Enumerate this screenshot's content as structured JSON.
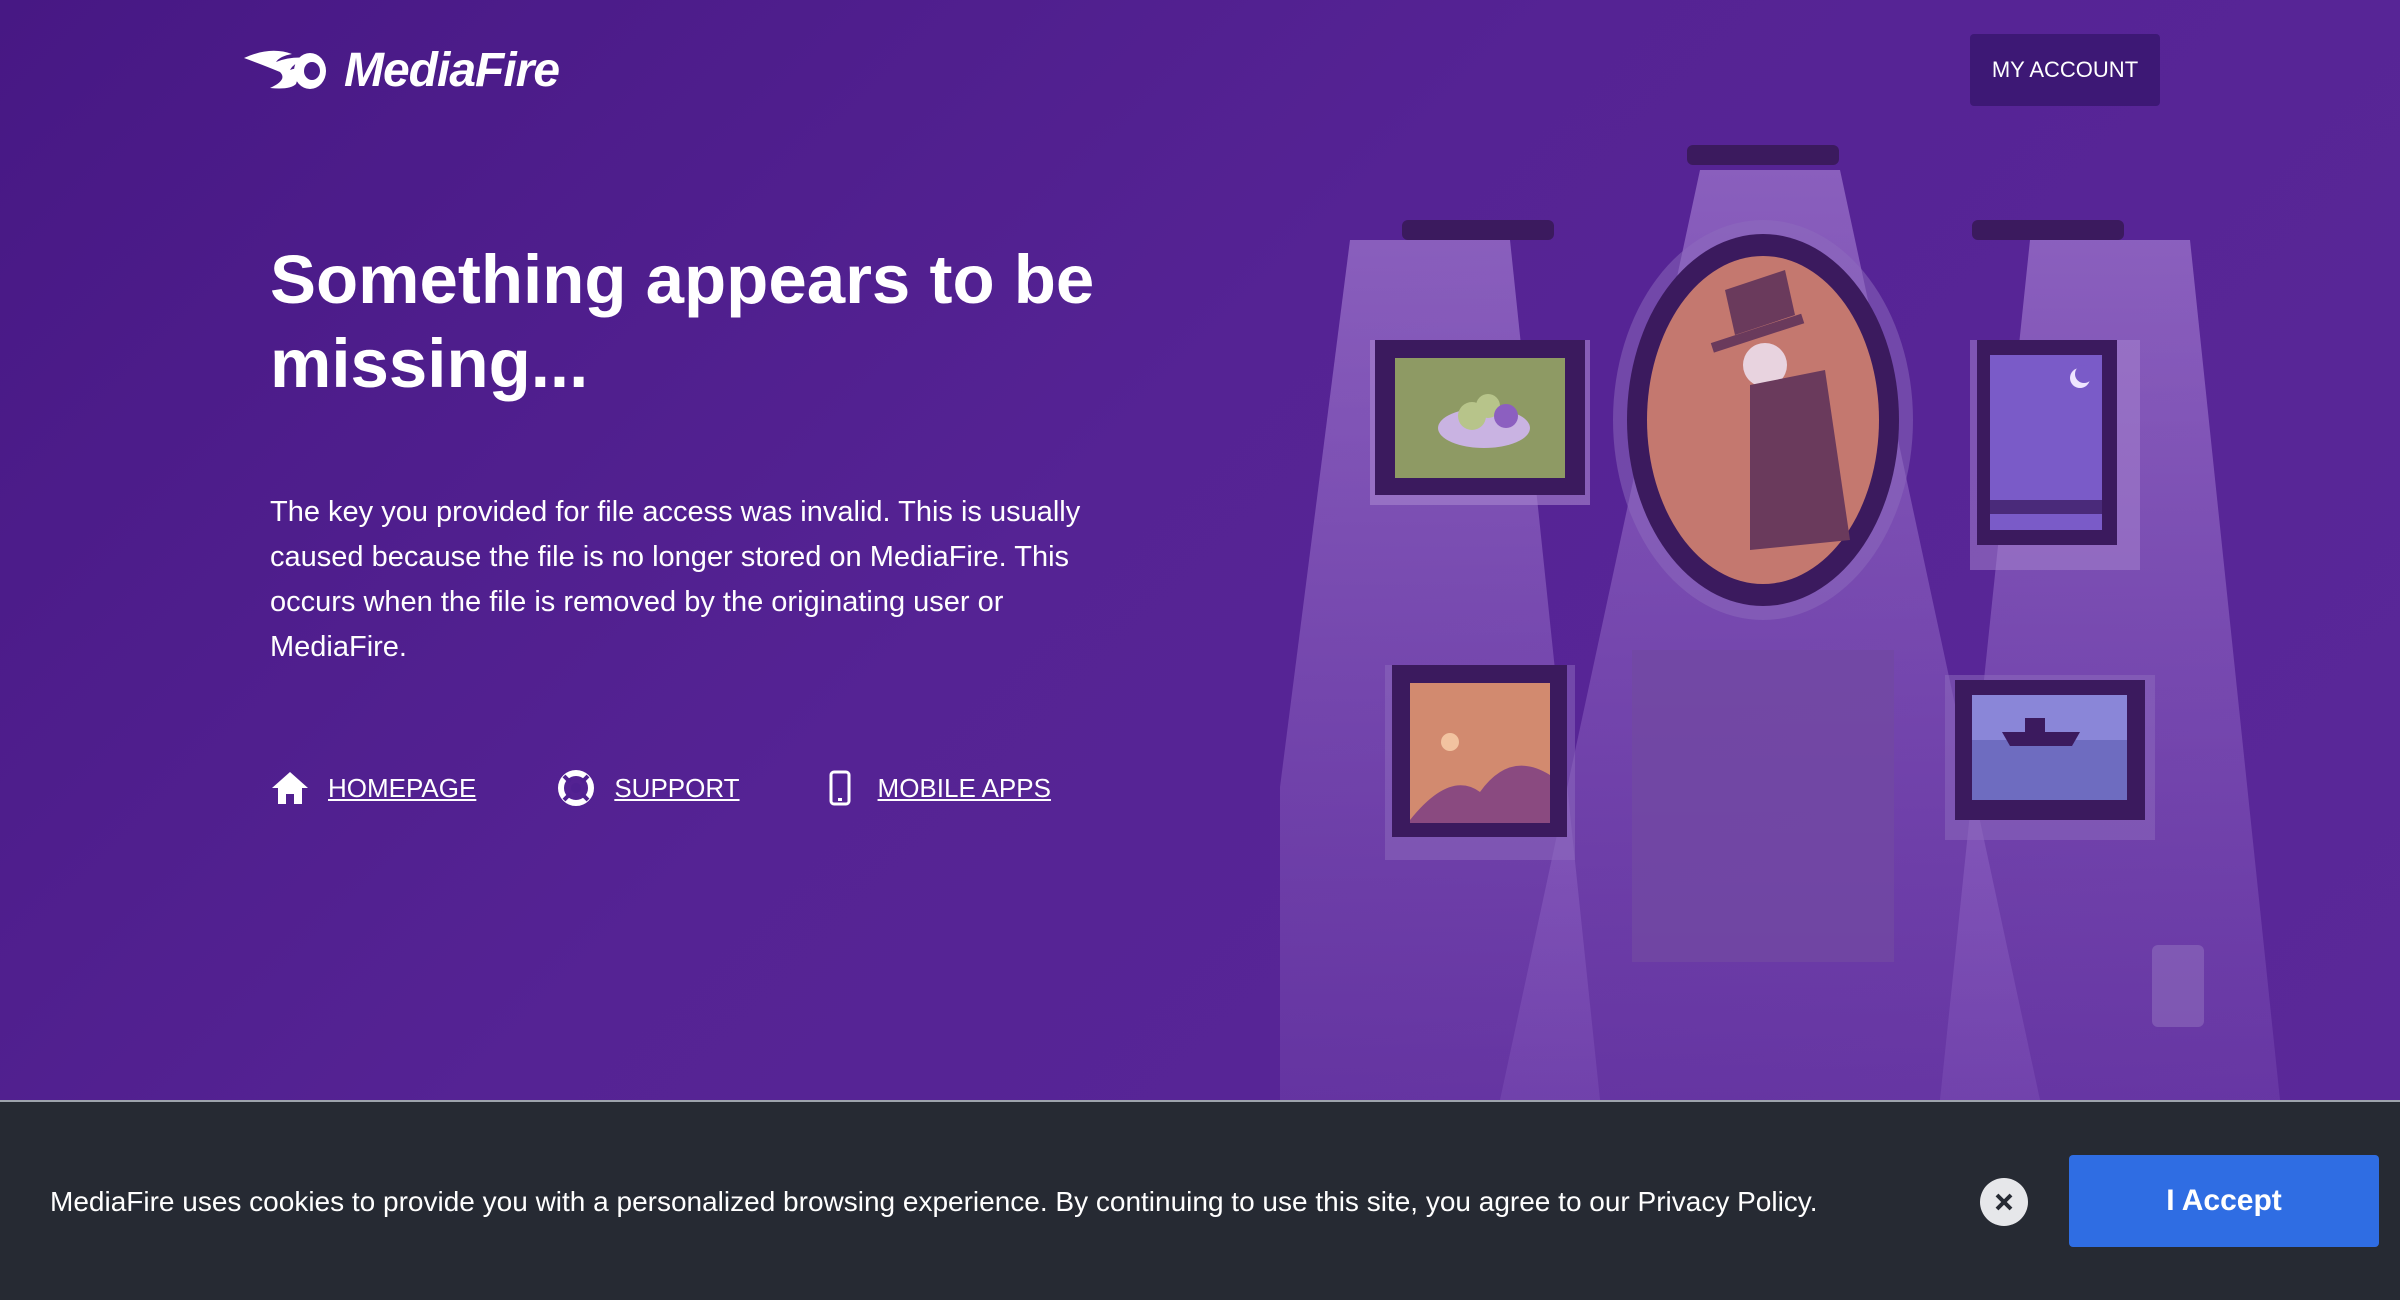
{
  "brand": {
    "name": "MediaFire"
  },
  "header": {
    "account_label": "MY ACCOUNT"
  },
  "main": {
    "title": "Something appears to be missing...",
    "description": "The key you provided for file access was invalid. This is usually caused because the file is no longer stored on MediaFire. This occurs when the file is removed by the originating user or MediaFire.",
    "links": [
      {
        "label": "HOMEPAGE",
        "icon": "home-icon"
      },
      {
        "label": "SUPPORT",
        "icon": "lifebuoy-icon"
      },
      {
        "label": "MOBILE APPS",
        "icon": "phone-icon"
      }
    ]
  },
  "cookie": {
    "text": "MediaFire uses cookies to provide you with a personalized browsing experience. By continuing to use this site, you agree to our Privacy Policy.",
    "accept_label": "I Accept",
    "close_icon": "close-icon"
  },
  "colors": {
    "background": "#4a1d8a",
    "frame": "#3b1a5e",
    "cookie_bar": "#262a33",
    "accept_button": "#2f6de3"
  }
}
